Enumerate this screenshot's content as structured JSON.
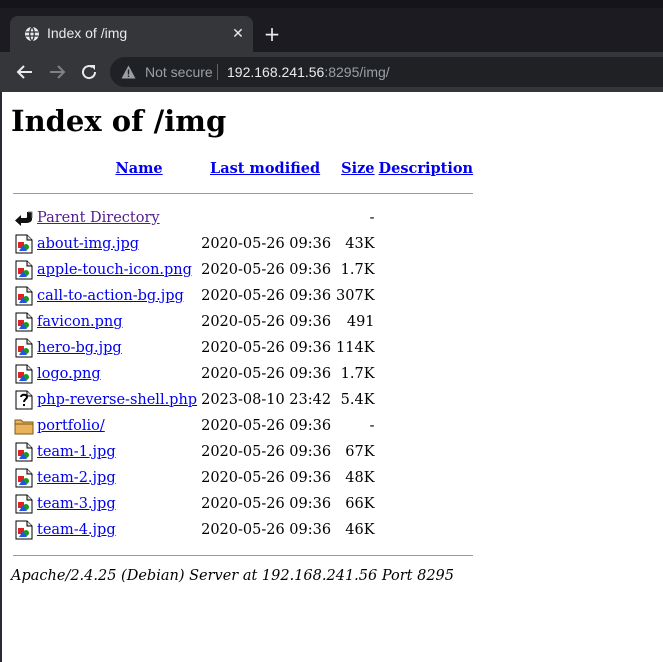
{
  "browser": {
    "tab_title": "Index of /img",
    "tab_close_glyph": "✕",
    "new_tab_glyph": "+",
    "security_label": "Not secure",
    "url_host": "192.168.241.56",
    "url_rest": ":8295/img/"
  },
  "page": {
    "heading": "Index of /img",
    "columns": {
      "name": "Name",
      "modified": "Last modified",
      "size": "Size",
      "description": "Description"
    },
    "rows": [
      {
        "icon": "back-icon",
        "name": "Parent Directory",
        "modified": "",
        "size": "-"
      },
      {
        "icon": "image-icon",
        "name": "about-img.jpg",
        "modified": "2020-05-26 09:36",
        "size": "43K"
      },
      {
        "icon": "image-icon",
        "name": "apple-touch-icon.png",
        "modified": "2020-05-26 09:36",
        "size": "1.7K"
      },
      {
        "icon": "image-icon",
        "name": "call-to-action-bg.jpg",
        "modified": "2020-05-26 09:36",
        "size": "307K"
      },
      {
        "icon": "image-icon",
        "name": "favicon.png",
        "modified": "2020-05-26 09:36",
        "size": "491"
      },
      {
        "icon": "image-icon",
        "name": "hero-bg.jpg",
        "modified": "2020-05-26 09:36",
        "size": "114K"
      },
      {
        "icon": "image-icon",
        "name": "logo.png",
        "modified": "2020-05-26 09:36",
        "size": "1.7K"
      },
      {
        "icon": "unknown-file-icon",
        "name": "php-reverse-shell.php",
        "modified": "2023-08-10 23:42",
        "size": "5.4K"
      },
      {
        "icon": "folder-icon",
        "name": "portfolio/",
        "modified": "2020-05-26 09:36",
        "size": "-"
      },
      {
        "icon": "image-icon",
        "name": "team-1.jpg",
        "modified": "2020-05-26 09:36",
        "size": "67K"
      },
      {
        "icon": "image-icon",
        "name": "team-2.jpg",
        "modified": "2020-05-26 09:36",
        "size": "48K"
      },
      {
        "icon": "image-icon",
        "name": "team-3.jpg",
        "modified": "2020-05-26 09:36",
        "size": "66K"
      },
      {
        "icon": "image-icon",
        "name": "team-4.jpg",
        "modified": "2020-05-26 09:36",
        "size": "46K"
      }
    ],
    "footer": "Apache/2.4.25 (Debian) Server at 192.168.241.56 Port 8295"
  },
  "colors": {
    "link": "#0000ee",
    "visited_link": "#551a8b",
    "chrome_bg": "#35363a",
    "omnibox_bg": "#202124"
  }
}
